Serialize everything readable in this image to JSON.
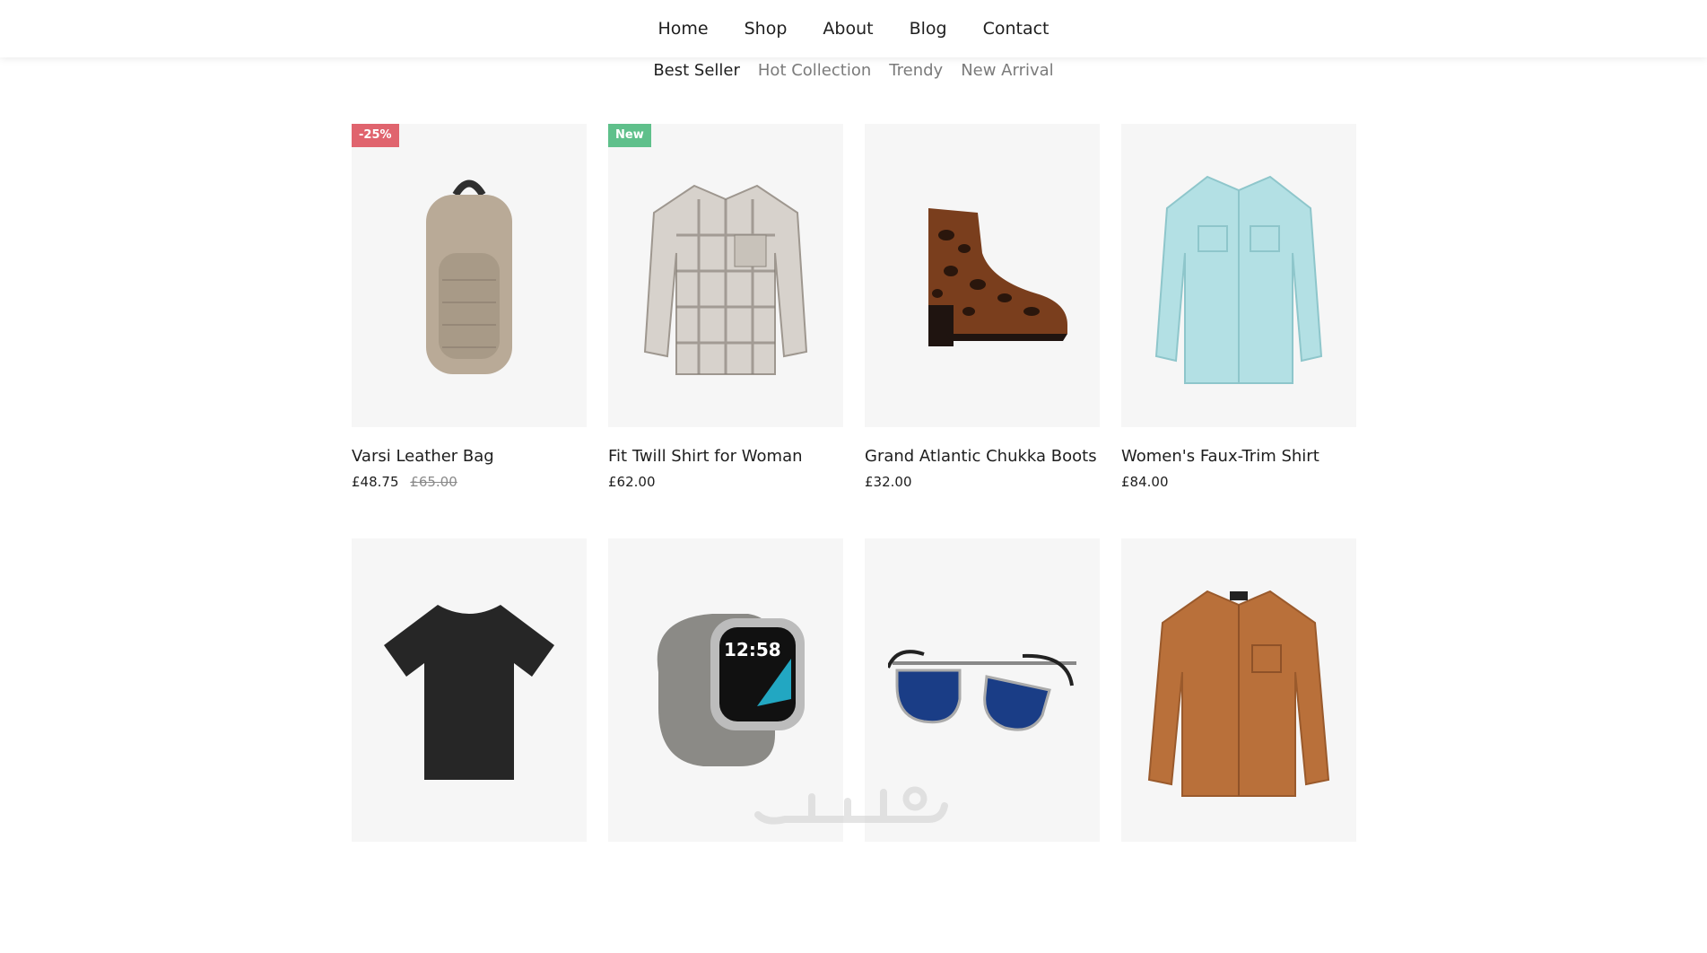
{
  "nav": {
    "items": [
      "Home",
      "Shop",
      "About",
      "Blog",
      "Contact"
    ]
  },
  "tabs": {
    "items": [
      "Best Seller",
      "Hot Collection",
      "Trendy",
      "New Arrival"
    ],
    "active": "Best Seller"
  },
  "products": [
    {
      "name": "Varsi Leather Bag",
      "price": "£48.75",
      "old_price": "£65.00",
      "badge": "-25%",
      "icon": "backpack-icon"
    },
    {
      "name": "Fit Twill Shirt for Woman",
      "price": "£62.00",
      "badge": "New",
      "icon": "plaid-shirt-icon"
    },
    {
      "name": "Grand Atlantic Chukka Boots",
      "price": "£32.00",
      "icon": "boot-icon"
    },
    {
      "name": "Women's Faux-Trim Shirt",
      "price": "£84.00",
      "icon": "blue-shirt-icon"
    },
    {
      "icon": "tshirt-icon"
    },
    {
      "watch_time": "12:58",
      "icon": "smartwatch-icon"
    },
    {
      "icon": "sunglasses-icon"
    },
    {
      "icon": "brown-shirt-icon"
    }
  ],
  "colors": {
    "sale_badge": "#e0646e",
    "new_badge": "#5fc08b",
    "thumb_bg": "#f6f6f6"
  }
}
